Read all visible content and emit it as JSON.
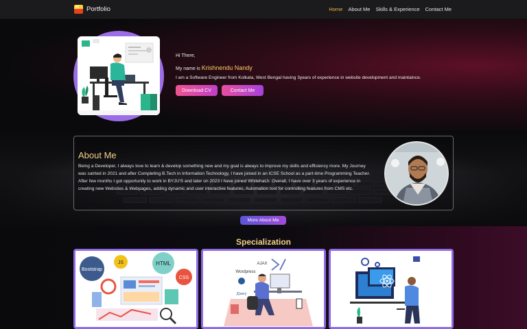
{
  "nav": {
    "brand": "Portfolio",
    "links": [
      "Home",
      "About Me",
      "Skills & Experience",
      "Contact Me"
    ],
    "active_index": 0
  },
  "hero": {
    "greeting": "Hi There,",
    "name_prefix": "My name is",
    "name": "Krishnendu Nandy",
    "intro": "I am a Software Engineer from Kolkata, West Bengal having 3years of experience in website development and maintaince.",
    "download_label": "Download CV",
    "contact_label": "Contact Me"
  },
  "about": {
    "title": "About Me",
    "text": "Being a Developer, I always love to learn & develop something new and my goal is always to improve my skills and efficiency more. My Journey was satrted in 2021 and after Completing B.Tech in Information Technology, I have joined in an ICSE School as a part-time Programming Teacher. After few months I got opportunity to work in BYJU'S and later on 2023 I have joined WhitehatJr. Overall, I have over 3 years of experience in creating new Websites & Webpages, adding dynamic and user interactive features, Automation tool for controlling features from CMS etc.",
    "more_label": "More About Me"
  },
  "specialization": {
    "title": "Specialization",
    "card1_tags": [
      "Bootstrap",
      "JS",
      "HTML",
      "CSS"
    ],
    "card2_tags": [
      "Wordpress",
      "AJAX",
      "jQuery"
    ]
  },
  "colors": {
    "accent": "#f2b440",
    "title_gold": "#f3d08a",
    "card_border": "#8f6ae6"
  }
}
